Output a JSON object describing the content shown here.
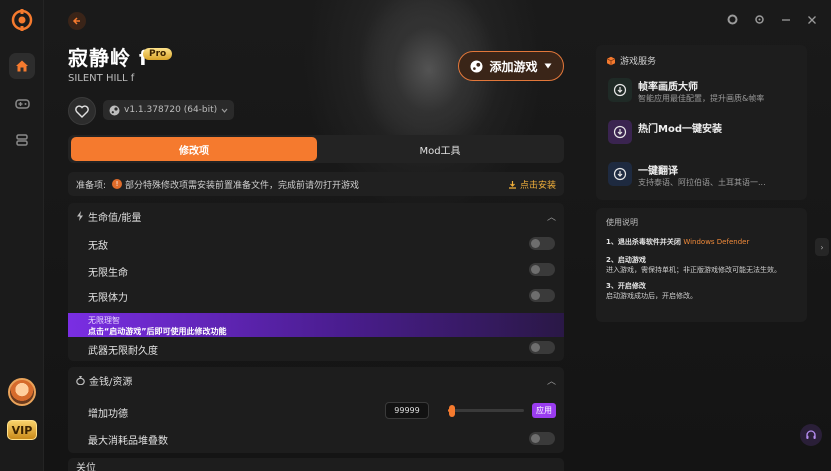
{
  "header": {
    "title": "寂静岭 f",
    "badge": "Pro",
    "subtitle": "SILENT HILL f",
    "version": "v1.1.378720 (64-bit)",
    "add_game": "添加游戏"
  },
  "tabs": [
    {
      "label": "修改项",
      "active": true
    },
    {
      "label": "Mod工具",
      "active": false
    }
  ],
  "prep": {
    "label": "准备项:",
    "text": "部分特殊修改项需安装前置准备文件，完成前请勿打开游戏",
    "action": "点击安装"
  },
  "sections": {
    "health": {
      "title": "生命值/能量",
      "rows": [
        {
          "label": "无敌",
          "on": false
        },
        {
          "label": "无限生命",
          "on": false
        },
        {
          "label": "无限体力",
          "on": false
        }
      ],
      "locked": {
        "label": "无限理智",
        "notice": "点击“启动游戏”后即可使用此修改功能"
      },
      "weapon": {
        "label": "武器无限耐久度",
        "on": false
      }
    },
    "money": {
      "title": "金钱/资源",
      "add_merit": {
        "label": "增加功德",
        "value": "99999",
        "apply": "应用",
        "slider_fraction": 0.05
      },
      "max_stack": {
        "label": "最大消耗品堆叠数",
        "on": false
      }
    },
    "next": {
      "title": "关位"
    }
  },
  "services": {
    "title": "游戏服务",
    "items": [
      {
        "name": "帧率画质大师",
        "desc": "智能应用最佳配置，提升画质&帧率"
      },
      {
        "name": "热门Mod一键安装",
        "desc": ""
      },
      {
        "name": "一键翻译",
        "desc": "支持泰语、阿拉伯语、土耳其语一..."
      }
    ]
  },
  "guide": {
    "title": "使用说明",
    "step1": "1、退出杀毒软件并关闭",
    "step1_accent": "Windows Defender",
    "step2": "2、启动游戏",
    "step2_desc": "进入游戏，需保持单机；非正版游戏修改可能无法生效。",
    "step3": "3、开启修改",
    "step3_desc": "启动游戏成功后，开启修改。"
  },
  "rail": {
    "vip": "VIP"
  },
  "colors": {
    "accent": "#f57a2e",
    "purple": "#9a3cf0",
    "gold": "#f3b13b"
  }
}
